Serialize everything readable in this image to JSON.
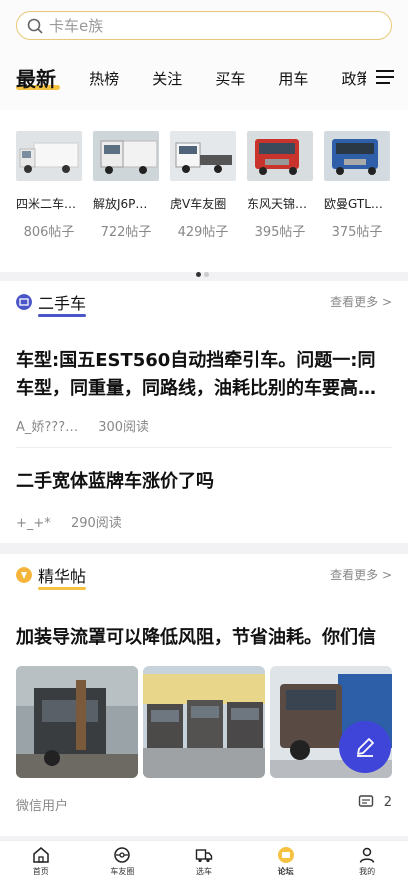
{
  "search": {
    "placeholder": "卡车e族"
  },
  "tabs": [
    "最新",
    "热榜",
    "关注",
    "买车",
    "用车",
    "政策"
  ],
  "circles": [
    {
      "name": "四米二车…",
      "count": "806帖子"
    },
    {
      "name": "解放J6P…",
      "count": "722帖子"
    },
    {
      "name": "虎V车友圈",
      "count": "429帖子"
    },
    {
      "name": "东风天锦…",
      "count": "395帖子"
    },
    {
      "name": "欧曼GTL…",
      "count": "375帖子"
    }
  ],
  "used_car": {
    "title": "二手车",
    "more": "查看更多 >",
    "posts": [
      {
        "title": "车型:国五EST560自动挡牵引车。问题一:同车型，同重量，同路线，油耗比别的车要高…",
        "author": "A_娇???…",
        "reads": "300阅读"
      },
      {
        "title": "二手宽体蓝牌车涨价了吗",
        "author": "+_+*",
        "reads": "290阅读"
      }
    ]
  },
  "featured": {
    "title": "精华帖",
    "more": "查看更多 >",
    "post": {
      "title": "加装导流罩可以降低风阻，节省油耗。你们信",
      "author": "微信用户",
      "comments": "2"
    }
  },
  "bottom_nav": [
    "首页",
    "车友圈",
    "选车",
    "论坛",
    "我的"
  ],
  "colors": {
    "accent": "#f5c242",
    "fab": "#3f45d8",
    "used_car_icon": "#4a55c9",
    "featured_icon": "#f5b53a"
  }
}
